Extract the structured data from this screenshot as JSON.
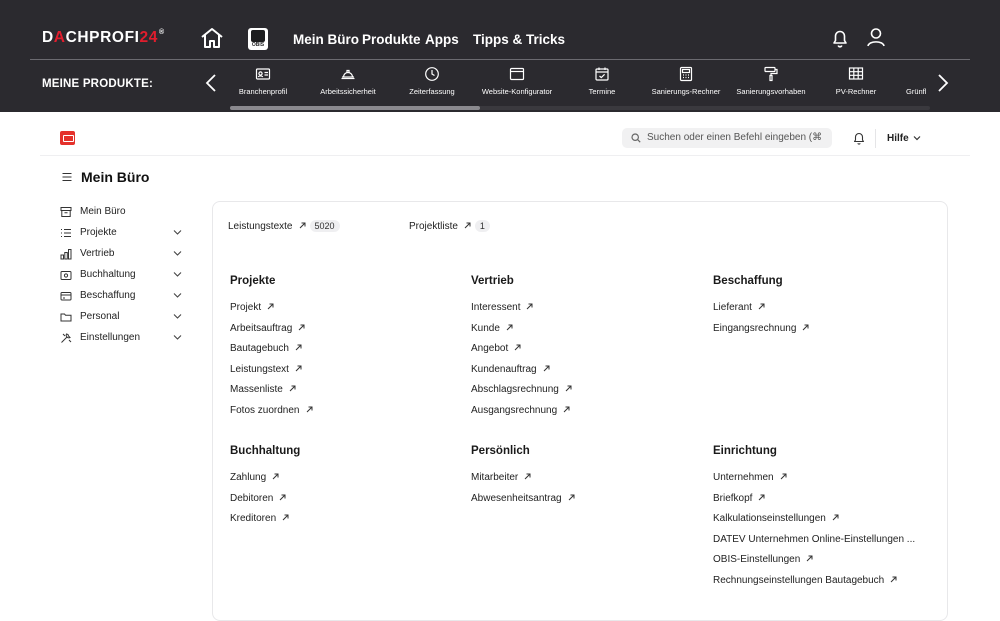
{
  "brand": {
    "logo_part1": "D",
    "logo_a": "A",
    "logo_part2": "CHPROFI",
    "logo_num": "24",
    "logo_reg": "®"
  },
  "topnav": {
    "item1": "Mein Büro",
    "item2": "Produkte",
    "item3": "Apps",
    "item4": "Tipps & Tricks"
  },
  "obis": {
    "label": "OBIS"
  },
  "products": {
    "heading": "MEINE PRODUKTE:",
    "items": [
      {
        "label": "Branchenprofil",
        "icon": "id-card-icon"
      },
      {
        "label": "Arbeitssicherheit",
        "icon": "helmet-icon"
      },
      {
        "label": "Zeiterfassung",
        "icon": "clock-icon"
      },
      {
        "label": "Website-Konfigurator",
        "icon": "browser-icon"
      },
      {
        "label": "Termine",
        "icon": "calendar-icon"
      },
      {
        "label": "Sanierungs-Rechner",
        "icon": "calculator-icon"
      },
      {
        "label": "Sanierungsvorhaben",
        "icon": "paint-roller-icon"
      },
      {
        "label": "PV-Rechner",
        "icon": "solar-grid-icon"
      },
      {
        "label": "Grünfl",
        "icon": "leaf-icon"
      }
    ]
  },
  "app": {
    "search_placeholder": "Suchen oder einen Befehl eingeben (⌘",
    "help_label": "Hilfe",
    "page_title": "Mein Büro"
  },
  "sidebar": {
    "items": [
      {
        "label": "Mein Büro"
      },
      {
        "label": "Projekte"
      },
      {
        "label": "Vertrieb"
      },
      {
        "label": "Buchhaltung"
      },
      {
        "label": "Beschaffung"
      },
      {
        "label": "Personal"
      },
      {
        "label": "Einstellungen"
      }
    ]
  },
  "quick": {
    "leistungstexte": {
      "label": "Leistungstexte",
      "count": "5020"
    },
    "projektliste": {
      "label": "Projektliste",
      "count": "1"
    }
  },
  "sections": {
    "projekte": {
      "title": "Projekte",
      "links": [
        "Projekt",
        "Arbeitsauftrag",
        "Bautagebuch",
        "Leistungstext",
        "Massenliste",
        "Fotos zuordnen"
      ]
    },
    "vertrieb": {
      "title": "Vertrieb",
      "links": [
        "Interessent",
        "Kunde",
        "Angebot",
        "Kundenauftrag",
        "Abschlagsrechnung",
        "Ausgangsrechnung"
      ]
    },
    "beschaffung": {
      "title": "Beschaffung",
      "links": [
        "Lieferant",
        "Eingangsrechnung"
      ]
    },
    "buchhaltung": {
      "title": "Buchhaltung",
      "links": [
        "Zahlung",
        "Debitoren",
        "Kreditoren"
      ]
    },
    "persoenlich": {
      "title": "Persönlich",
      "links": [
        "Mitarbeiter",
        "Abwesenheitsantrag"
      ]
    },
    "einrichtung": {
      "title": "Einrichtung",
      "links": [
        "Unternehmen",
        "Briefkopf",
        "Kalkulationseinstellungen",
        "DATEV Unternehmen Online-Einstellungen ...",
        "OBIS-Einstellungen",
        "Rechnungseinstellungen Bautagebuch"
      ]
    }
  },
  "colors": {
    "topbar": "#2b2a2f",
    "accent": "#e11d2d"
  }
}
